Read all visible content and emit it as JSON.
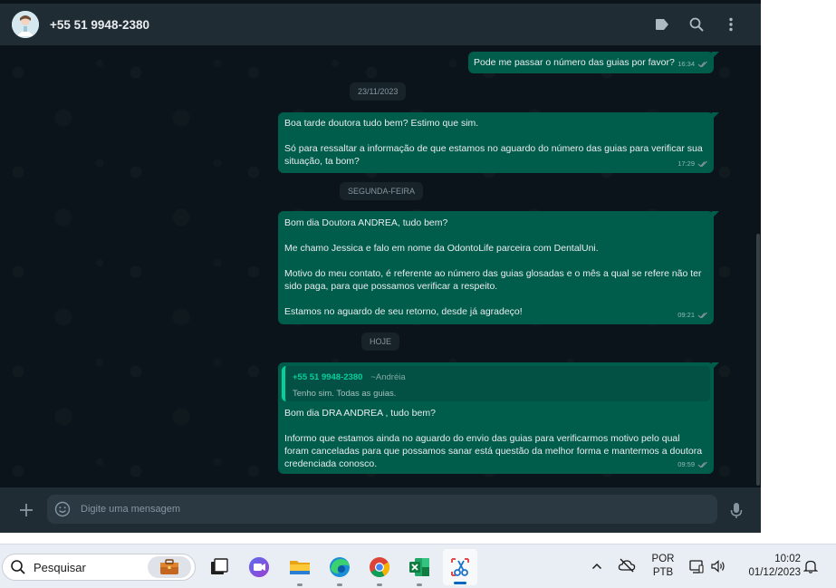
{
  "header": {
    "contact_name": "+55 51 9948-2380",
    "icons": [
      "avatar",
      "label-icon",
      "search-icon",
      "menu-icon"
    ]
  },
  "messages": {
    "date_chips": [
      "23/11/2023",
      "SEGUNDA-FEIRA",
      "HOJE"
    ],
    "items": [
      {
        "text": "Pode me passar o número das guias por favor?",
        "time": "16:34",
        "status": "read"
      },
      {
        "text": "Boa tarde doutora tudo bem? Estimo que sim.\n\nSó para ressaltar a informação de que estamos no aguardo do número das guias para verificar sua situação, ta bom?",
        "time": "17:29",
        "status": "read"
      },
      {
        "text": "Bom dia Doutora ANDREA, tudo bem?\n\nMe chamo Jessica e falo em nome da OdontoLife parceira com DentalUni.\n\nMotivo do meu contato, é referente ao número das guias glosadas e o mês a qual se refere não ter sido paga, para que possamos verificar a respeito.\n\nEstamos no aguardo de seu retorno, desde já agradeço!",
        "time": "09:21",
        "status": "read"
      },
      {
        "quote": {
          "author": "+55 51 9948-2380",
          "push_name": "~Andréia",
          "text": "Tenho sim. Todas as guias."
        },
        "text": "Bom dia DRA ANDREA , tudo bem?\n\nInformo que estamos ainda no aguardo do envio das guias para verificarmos motivo pelo qual foram canceladas para que possamos sanar está questão da melhor forma e mantermos a doutora credenciada conosco.",
        "time": "09:59",
        "status": "read"
      }
    ]
  },
  "composer": {
    "placeholder": "Digite uma mensagem"
  },
  "taskbar": {
    "search_placeholder": "Pesquisar",
    "apps": [
      "briefcase-icon",
      "task-view-icon",
      "teams-icon",
      "file-explorer-icon",
      "edge-icon",
      "chrome-icon",
      "excel-icon",
      "snipping-tool-icon"
    ],
    "language": "POR",
    "keyboard": "PTB",
    "time": "10:02",
    "date": "01/12/2023"
  },
  "colors": {
    "chat_bg": "#0b141a",
    "header_bg": "#202c33",
    "bubble_out": "#005c4b",
    "accent": "#06cf9c",
    "read_ticks": "#8696a0"
  }
}
